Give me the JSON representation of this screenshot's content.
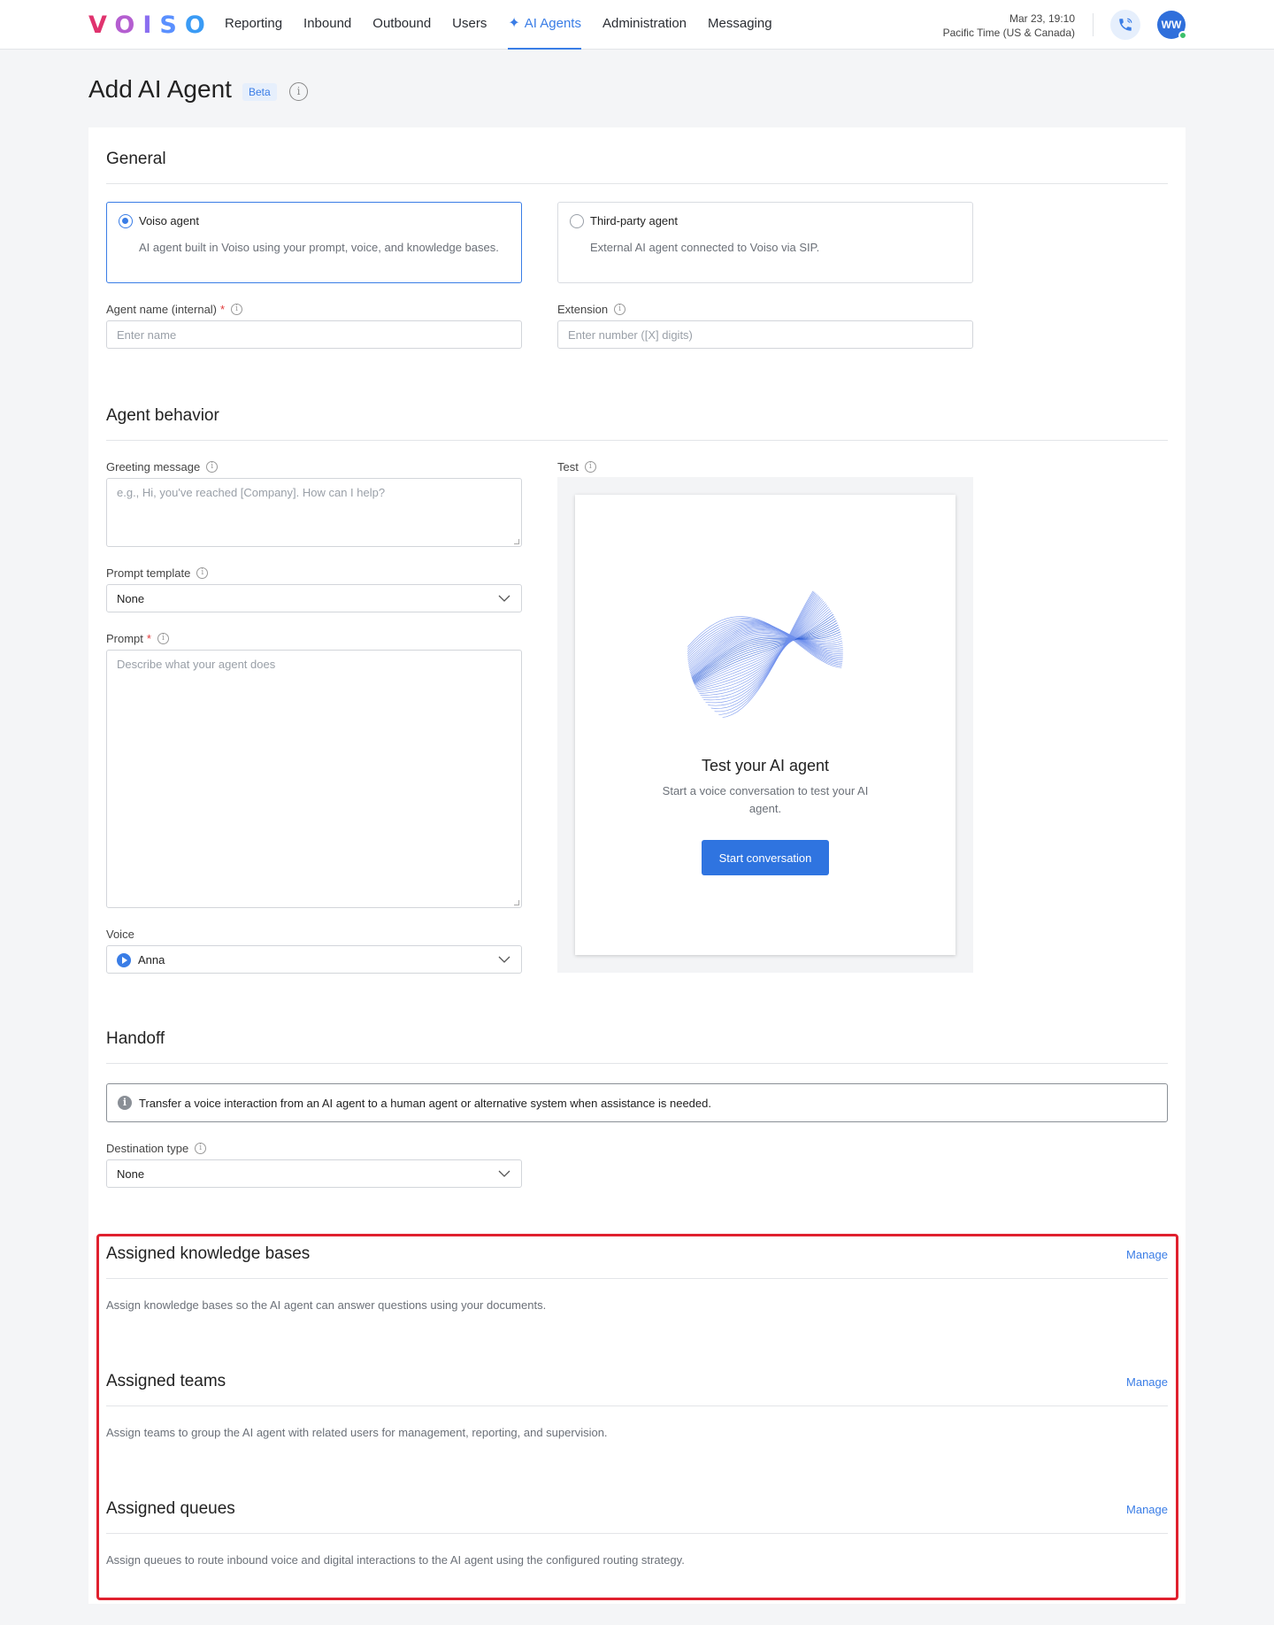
{
  "logo": {
    "letters": [
      "V",
      "O",
      "I",
      "S",
      "O"
    ]
  },
  "nav": {
    "items": [
      {
        "label": "Reporting"
      },
      {
        "label": "Inbound"
      },
      {
        "label": "Outbound"
      },
      {
        "label": "Users"
      },
      {
        "label": "AI Agents",
        "active": true
      },
      {
        "label": "Administration"
      },
      {
        "label": "Messaging"
      }
    ],
    "datetime": "Mar 23, 19:10",
    "timezone": "Pacific Time (US & Canada)",
    "avatar_initials": "WW"
  },
  "page": {
    "title": "Add AI Agent",
    "badge": "Beta"
  },
  "general": {
    "title": "General",
    "options": [
      {
        "label": "Voiso agent",
        "desc": "AI agent built in Voiso using your prompt, voice, and knowledge bases.",
        "selected": true
      },
      {
        "label": "Third-party agent",
        "desc": "External AI agent connected to Voiso via SIP.",
        "selected": false
      }
    ],
    "agent_name_label": "Agent name (internal)",
    "agent_name_placeholder": "Enter name",
    "extension_label": "Extension",
    "extension_placeholder": "Enter number ([X] digits)"
  },
  "behavior": {
    "title": "Agent behavior",
    "greeting_label": "Greeting message",
    "greeting_placeholder": "e.g., Hi, you've reached [Company]. How can I help?",
    "prompt_template_label": "Prompt template",
    "prompt_template_value": "None",
    "prompt_label": "Prompt",
    "prompt_placeholder": "Describe what your agent does",
    "voice_label": "Voice",
    "voice_value": "Anna",
    "test_label": "Test",
    "test_title": "Test your AI agent",
    "test_desc": "Start a voice conversation to test your AI agent.",
    "start_button": "Start conversation"
  },
  "handoff": {
    "title": "Handoff",
    "info": "Transfer a voice interaction from an AI agent to a human agent or alternative system when assistance is needed.",
    "destination_label": "Destination type",
    "destination_value": "None"
  },
  "assigned": [
    {
      "title": "Assigned knowledge bases",
      "manage": "Manage",
      "desc": "Assign knowledge bases so the AI agent can answer questions using your documents."
    },
    {
      "title": "Assigned teams",
      "manage": "Manage",
      "desc": "Assign teams to group the AI agent with related users for management, reporting, and supervision."
    },
    {
      "title": "Assigned queues",
      "manage": "Manage",
      "desc": "Assign queues to route inbound voice and digital interactions to the AI agent using the configured routing strategy."
    }
  ],
  "colors": {
    "accent": "#3a7de6",
    "highlight": "#e0202e",
    "required": "#e03a3a"
  }
}
